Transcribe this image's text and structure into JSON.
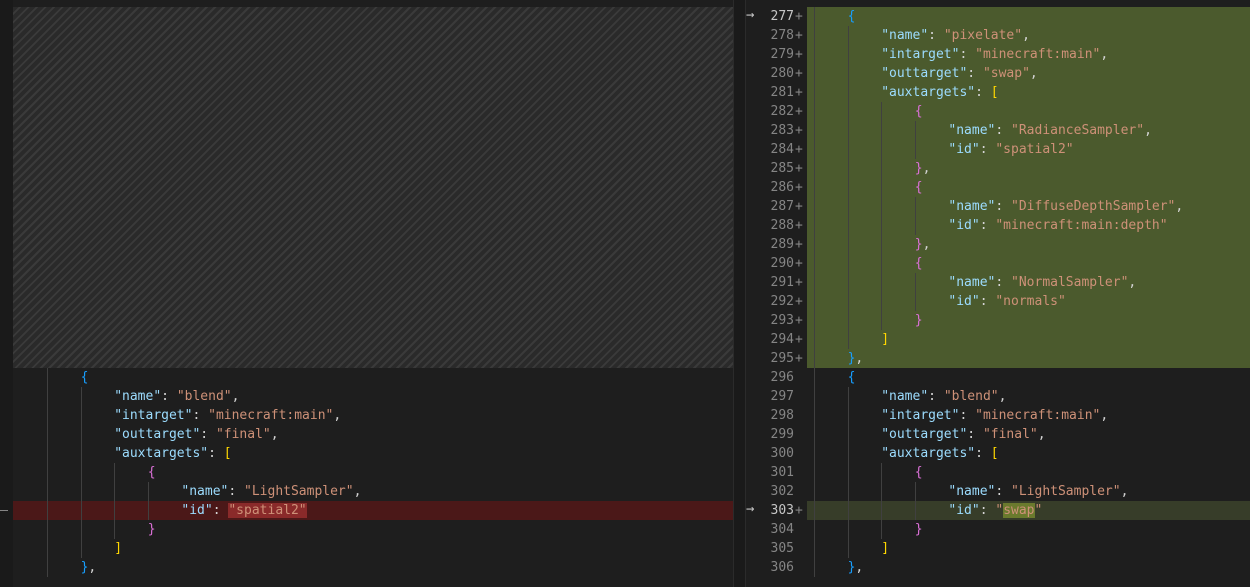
{
  "left_pane": {
    "lines": [
      {
        "indent": 2,
        "segments": [
          {
            "t": "{",
            "c": "b1"
          }
        ]
      },
      {
        "indent": 3,
        "segments": [
          {
            "t": "\"name\"",
            "c": "k"
          },
          {
            "t": ": ",
            "c": "p"
          },
          {
            "t": "\"blend\"",
            "c": "s"
          },
          {
            "t": ",",
            "c": "p"
          }
        ]
      },
      {
        "indent": 3,
        "segments": [
          {
            "t": "\"intarget\"",
            "c": "k"
          },
          {
            "t": ": ",
            "c": "p"
          },
          {
            "t": "\"minecraft:main\"",
            "c": "s"
          },
          {
            "t": ",",
            "c": "p"
          }
        ]
      },
      {
        "indent": 3,
        "segments": [
          {
            "t": "\"outtarget\"",
            "c": "k"
          },
          {
            "t": ": ",
            "c": "p"
          },
          {
            "t": "\"final\"",
            "c": "s"
          },
          {
            "t": ",",
            "c": "p"
          }
        ]
      },
      {
        "indent": 3,
        "segments": [
          {
            "t": "\"auxtargets\"",
            "c": "k"
          },
          {
            "t": ": ",
            "c": "p"
          },
          {
            "t": "[",
            "c": "b2"
          }
        ]
      },
      {
        "indent": 4,
        "segments": [
          {
            "t": "{",
            "c": "b3"
          }
        ]
      },
      {
        "indent": 5,
        "segments": [
          {
            "t": "\"name\"",
            "c": "k"
          },
          {
            "t": ": ",
            "c": "p"
          },
          {
            "t": "\"LightSampler\"",
            "c": "s"
          },
          {
            "t": ",",
            "c": "p"
          }
        ]
      },
      {
        "indent": 5,
        "deleted": true,
        "segments": [
          {
            "t": "\"id\"",
            "c": "k"
          },
          {
            "t": ": ",
            "c": "p"
          },
          {
            "t": "\"spatial2\"",
            "c": "s",
            "hl": "del"
          }
        ]
      },
      {
        "indent": 4,
        "segments": [
          {
            "t": "}",
            "c": "b3"
          }
        ]
      },
      {
        "indent": 3,
        "segments": [
          {
            "t": "]",
            "c": "b2"
          }
        ]
      },
      {
        "indent": 2,
        "segments": [
          {
            "t": "}",
            "c": "b1"
          },
          {
            "t": ",",
            "c": "p"
          }
        ]
      }
    ]
  },
  "right_pane": {
    "lines": [
      {
        "num": "277",
        "marker": "+",
        "inserted": true,
        "arrow": true,
        "indent": 2,
        "segments": [
          {
            "t": "{",
            "c": "b1"
          }
        ]
      },
      {
        "num": "278",
        "marker": "+",
        "inserted": true,
        "indent": 3,
        "segments": [
          {
            "t": "\"name\"",
            "c": "k"
          },
          {
            "t": ": ",
            "c": "p"
          },
          {
            "t": "\"pixelate\"",
            "c": "s"
          },
          {
            "t": ",",
            "c": "p"
          }
        ]
      },
      {
        "num": "279",
        "marker": "+",
        "inserted": true,
        "indent": 3,
        "segments": [
          {
            "t": "\"intarget\"",
            "c": "k"
          },
          {
            "t": ": ",
            "c": "p"
          },
          {
            "t": "\"minecraft:main\"",
            "c": "s"
          },
          {
            "t": ",",
            "c": "p"
          }
        ]
      },
      {
        "num": "280",
        "marker": "+",
        "inserted": true,
        "indent": 3,
        "segments": [
          {
            "t": "\"outtarget\"",
            "c": "k"
          },
          {
            "t": ": ",
            "c": "p"
          },
          {
            "t": "\"swap\"",
            "c": "s"
          },
          {
            "t": ",",
            "c": "p"
          }
        ]
      },
      {
        "num": "281",
        "marker": "+",
        "inserted": true,
        "indent": 3,
        "segments": [
          {
            "t": "\"auxtargets\"",
            "c": "k"
          },
          {
            "t": ": ",
            "c": "p"
          },
          {
            "t": "[",
            "c": "b2"
          }
        ]
      },
      {
        "num": "282",
        "marker": "+",
        "inserted": true,
        "indent": 4,
        "segments": [
          {
            "t": "{",
            "c": "b3"
          }
        ]
      },
      {
        "num": "283",
        "marker": "+",
        "inserted": true,
        "indent": 5,
        "segments": [
          {
            "t": "\"name\"",
            "c": "k"
          },
          {
            "t": ": ",
            "c": "p"
          },
          {
            "t": "\"RadianceSampler\"",
            "c": "s"
          },
          {
            "t": ",",
            "c": "p"
          }
        ]
      },
      {
        "num": "284",
        "marker": "+",
        "inserted": true,
        "indent": 5,
        "segments": [
          {
            "t": "\"id\"",
            "c": "k"
          },
          {
            "t": ": ",
            "c": "p"
          },
          {
            "t": "\"spatial2\"",
            "c": "s"
          }
        ]
      },
      {
        "num": "285",
        "marker": "+",
        "inserted": true,
        "indent": 4,
        "segments": [
          {
            "t": "}",
            "c": "b3"
          },
          {
            "t": ",",
            "c": "p"
          }
        ]
      },
      {
        "num": "286",
        "marker": "+",
        "inserted": true,
        "indent": 4,
        "segments": [
          {
            "t": "{",
            "c": "b3"
          }
        ]
      },
      {
        "num": "287",
        "marker": "+",
        "inserted": true,
        "indent": 5,
        "segments": [
          {
            "t": "\"name\"",
            "c": "k"
          },
          {
            "t": ": ",
            "c": "p"
          },
          {
            "t": "\"DiffuseDepthSampler\"",
            "c": "s"
          },
          {
            "t": ",",
            "c": "p"
          }
        ]
      },
      {
        "num": "288",
        "marker": "+",
        "inserted": true,
        "indent": 5,
        "segments": [
          {
            "t": "\"id\"",
            "c": "k"
          },
          {
            "t": ": ",
            "c": "p"
          },
          {
            "t": "\"minecraft:main:depth\"",
            "c": "s"
          }
        ]
      },
      {
        "num": "289",
        "marker": "+",
        "inserted": true,
        "indent": 4,
        "segments": [
          {
            "t": "}",
            "c": "b3"
          },
          {
            "t": ",",
            "c": "p"
          }
        ]
      },
      {
        "num": "290",
        "marker": "+",
        "inserted": true,
        "indent": 4,
        "segments": [
          {
            "t": "{",
            "c": "b3"
          }
        ]
      },
      {
        "num": "291",
        "marker": "+",
        "inserted": true,
        "indent": 5,
        "segments": [
          {
            "t": "\"name\"",
            "c": "k"
          },
          {
            "t": ": ",
            "c": "p"
          },
          {
            "t": "\"NormalSampler\"",
            "c": "s"
          },
          {
            "t": ",",
            "c": "p"
          }
        ]
      },
      {
        "num": "292",
        "marker": "+",
        "inserted": true,
        "indent": 5,
        "segments": [
          {
            "t": "\"id\"",
            "c": "k"
          },
          {
            "t": ": ",
            "c": "p"
          },
          {
            "t": "\"normals\"",
            "c": "s"
          }
        ]
      },
      {
        "num": "293",
        "marker": "+",
        "inserted": true,
        "indent": 4,
        "segments": [
          {
            "t": "}",
            "c": "b3"
          }
        ]
      },
      {
        "num": "294",
        "marker": "+",
        "inserted": true,
        "indent": 3,
        "segments": [
          {
            "t": "]",
            "c": "b2"
          }
        ]
      },
      {
        "num": "295",
        "marker": "+",
        "inserted": true,
        "indent": 2,
        "segments": [
          {
            "t": "}",
            "c": "b1"
          },
          {
            "t": ",",
            "c": "p"
          }
        ]
      },
      {
        "num": "296",
        "marker": "",
        "indent": 2,
        "segments": [
          {
            "t": "{",
            "c": "b1"
          }
        ]
      },
      {
        "num": "297",
        "marker": "",
        "indent": 3,
        "segments": [
          {
            "t": "\"name\"",
            "c": "k"
          },
          {
            "t": ": ",
            "c": "p"
          },
          {
            "t": "\"blend\"",
            "c": "s"
          },
          {
            "t": ",",
            "c": "p"
          }
        ]
      },
      {
        "num": "298",
        "marker": "",
        "indent": 3,
        "segments": [
          {
            "t": "\"intarget\"",
            "c": "k"
          },
          {
            "t": ": ",
            "c": "p"
          },
          {
            "t": "\"minecraft:main\"",
            "c": "s"
          },
          {
            "t": ",",
            "c": "p"
          }
        ]
      },
      {
        "num": "299",
        "marker": "",
        "indent": 3,
        "segments": [
          {
            "t": "\"outtarget\"",
            "c": "k"
          },
          {
            "t": ": ",
            "c": "p"
          },
          {
            "t": "\"final\"",
            "c": "s"
          },
          {
            "t": ",",
            "c": "p"
          }
        ]
      },
      {
        "num": "300",
        "marker": "",
        "indent": 3,
        "segments": [
          {
            "t": "\"auxtargets\"",
            "c": "k"
          },
          {
            "t": ": ",
            "c": "p"
          },
          {
            "t": "[",
            "c": "b2"
          }
        ]
      },
      {
        "num": "301",
        "marker": "",
        "indent": 4,
        "segments": [
          {
            "t": "{",
            "c": "b3"
          }
        ]
      },
      {
        "num": "302",
        "marker": "",
        "indent": 5,
        "segments": [
          {
            "t": "\"name\"",
            "c": "k"
          },
          {
            "t": ": ",
            "c": "p"
          },
          {
            "t": "\"LightSampler\"",
            "c": "s"
          },
          {
            "t": ",",
            "c": "p"
          }
        ]
      },
      {
        "num": "303",
        "marker": "+",
        "modified": true,
        "arrow": true,
        "indent": 5,
        "segments": [
          {
            "t": "\"id\"",
            "c": "k"
          },
          {
            "t": ": ",
            "c": "p"
          },
          {
            "t": "\"",
            "c": "s"
          },
          {
            "t": "swap",
            "c": "s",
            "hl": "ins"
          },
          {
            "t": "\"",
            "c": "s"
          }
        ]
      },
      {
        "num": "304",
        "marker": "",
        "indent": 4,
        "segments": [
          {
            "t": "}",
            "c": "b3"
          }
        ]
      },
      {
        "num": "305",
        "marker": "",
        "indent": 3,
        "segments": [
          {
            "t": "]",
            "c": "b2"
          }
        ]
      },
      {
        "num": "306",
        "marker": "",
        "indent": 2,
        "segments": [
          {
            "t": "}",
            "c": "b1"
          },
          {
            "t": ",",
            "c": "p"
          }
        ]
      }
    ]
  },
  "glyphs": {
    "arrow": "→"
  },
  "colors": {
    "inserted_bg": "#4b5a2d",
    "deleted_bg": "#4b1818",
    "key": "#9cdcfe",
    "string": "#ce9178"
  }
}
